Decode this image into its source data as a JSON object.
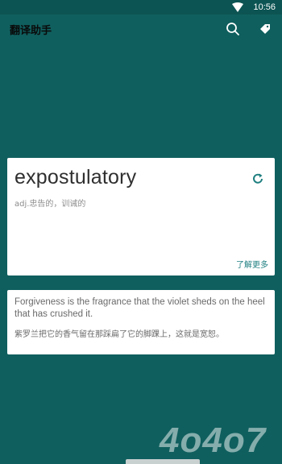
{
  "status": {
    "time": "10:56"
  },
  "app": {
    "title": "翻译助手"
  },
  "toolbar": {
    "search_icon": "search-icon",
    "tag_icon": "tag-icon"
  },
  "word_card": {
    "word": "expostulatory",
    "definition": "adj.忠告的，训诫的",
    "more_link": "了解更多"
  },
  "quote_card": {
    "english": "Forgiveness is the fragrance that the violet sheds on the heel that has crushed it.",
    "chinese": "紫罗兰把它的香气留在那踩扁了它的脚踝上，这就是宽恕。"
  },
  "watermark": {
    "text": "4o4o7"
  },
  "colors": {
    "background": "#0f5f5e",
    "accent": "#1f7f80",
    "card": "#ffffff"
  }
}
